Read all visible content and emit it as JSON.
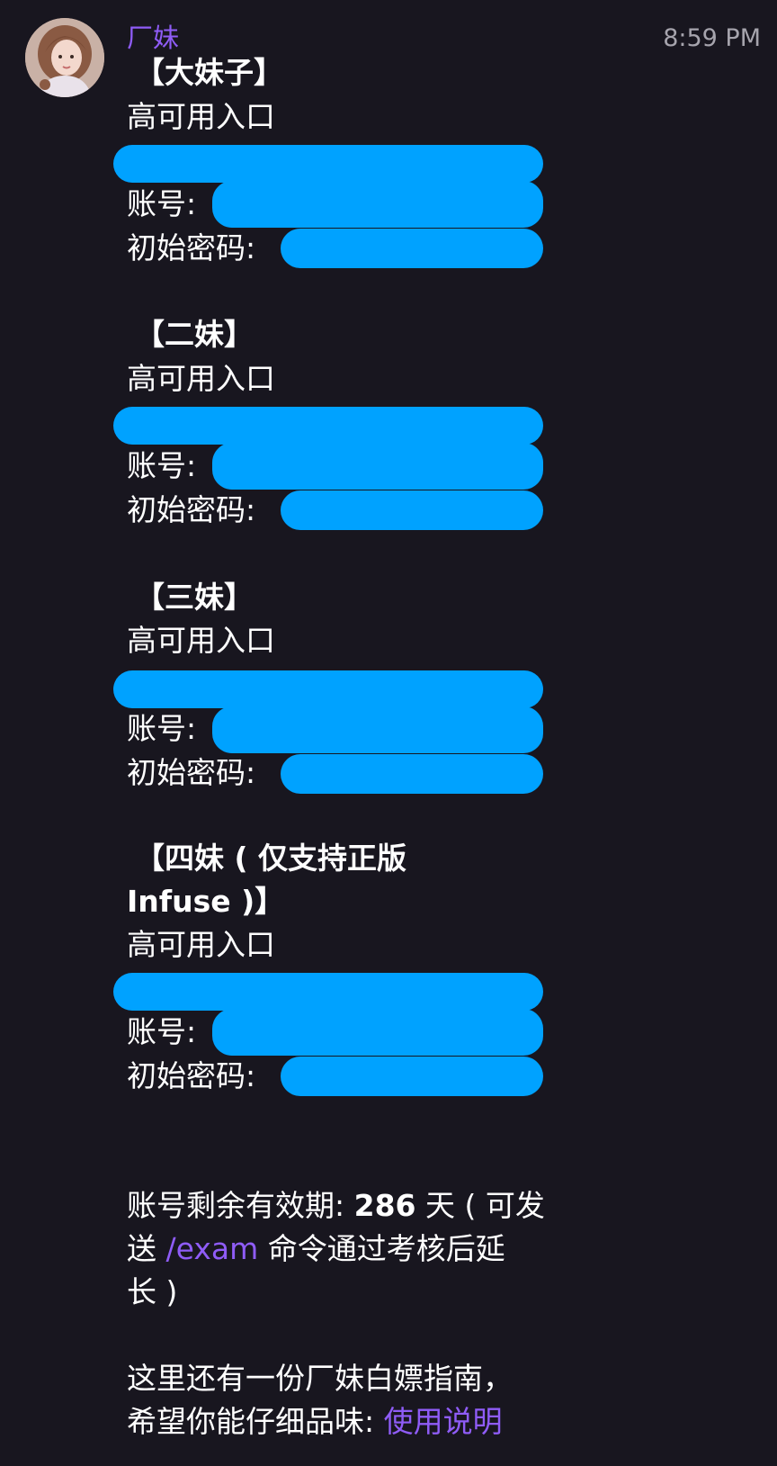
{
  "message": {
    "sender": "厂妹",
    "time": "8:59 PM"
  },
  "blocks": [
    {
      "title": "【大妹子】",
      "entry_label": "高可用入口",
      "account_label": "账号:",
      "password_label": "初始密码:"
    },
    {
      "title": "【二妹】",
      "entry_label": "高可用入口",
      "account_label": "账号:",
      "password_label": "初始密码:"
    },
    {
      "title": "【三妹】",
      "entry_label": "高可用入口",
      "account_label": "账号:",
      "password_label": "初始密码:"
    },
    {
      "title_line1": "【四妹 ( 仅支持正版",
      "title_line2": "Infuse )】",
      "entry_label": "高可用入口",
      "account_label": "账号:",
      "password_label": "初始密码:"
    }
  ],
  "validity": {
    "prefix": "账号剩余有效期: ",
    "days": "286",
    "suffix": " 天 ( 可发",
    "line2_start": "送 ",
    "command": "/exam",
    "line2_end": " 命令通过考核后延",
    "line3": "长 )"
  },
  "guide": {
    "line1": "这里还有一份厂妹白嫖指南，",
    "line2_start": "希望你能仔细品味: ",
    "link": "使用说明"
  },
  "colors": {
    "background": "#18161f",
    "text": "#ffffff",
    "accent_purple": "#8f5cf7",
    "redaction_blue": "#00a2ff",
    "timestamp": "#a6a4ad"
  },
  "icons": {
    "avatar": "user-avatar-photo"
  }
}
